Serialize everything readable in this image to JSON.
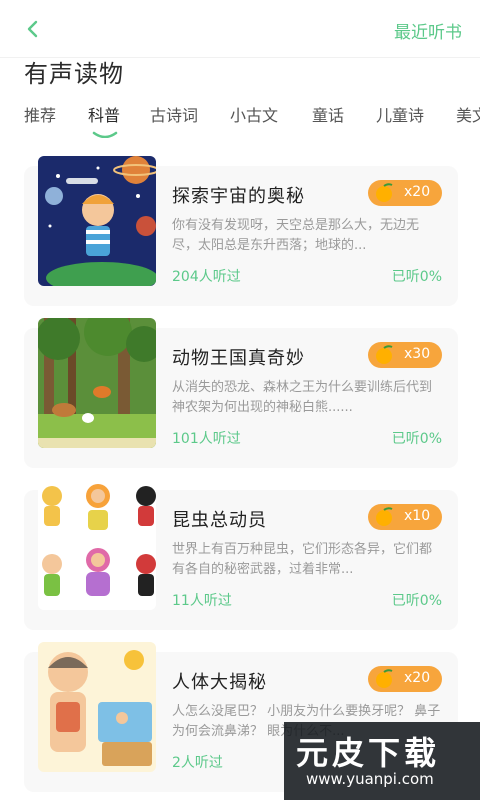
{
  "header": {
    "recent_label": "最近听书"
  },
  "page": {
    "title": "有声读物"
  },
  "tabs": [
    {
      "label": "推荐"
    },
    {
      "label": "科普",
      "active": true
    },
    {
      "label": "古诗词"
    },
    {
      "label": "小古文"
    },
    {
      "label": "童话"
    },
    {
      "label": "儿童诗"
    },
    {
      "label": "美文"
    }
  ],
  "cards": [
    {
      "title": "探索宇宙的奥秘",
      "coins": "x20",
      "description": "你有没有发现呀，天空总是那么大，无边无尽，太阳总是东升西落；地球的...",
      "listeners": "204人听过",
      "progress": "已听0%"
    },
    {
      "title": "动物王国真奇妙",
      "coins": "x30",
      "description": "从消失的恐龙、森林之王为什么要训练后代到神农架为何出现的神秘白熊......",
      "listeners": "101人听过",
      "progress": "已听0%"
    },
    {
      "title": "昆虫总动员",
      "coins": "x10",
      "description": "世界上有百万种昆虫，它们形态各异，它们都有各自的秘密武器，过着非常...",
      "listeners": "11人听过",
      "progress": "已听0%"
    },
    {
      "title": "人体大揭秘",
      "coins": "x20",
      "description": "人怎么没尾巴？ 小朋友为什么要换牙呢？ 鼻子为何会流鼻涕？ 眼为什么不...",
      "listeners": "2人听过",
      "progress": ""
    }
  ],
  "watermark": {
    "title": "元皮下载",
    "url": "www.yuanpi.com"
  },
  "colors": {
    "accent": "#5cc98a",
    "coin_badge": "#f7a53c"
  }
}
